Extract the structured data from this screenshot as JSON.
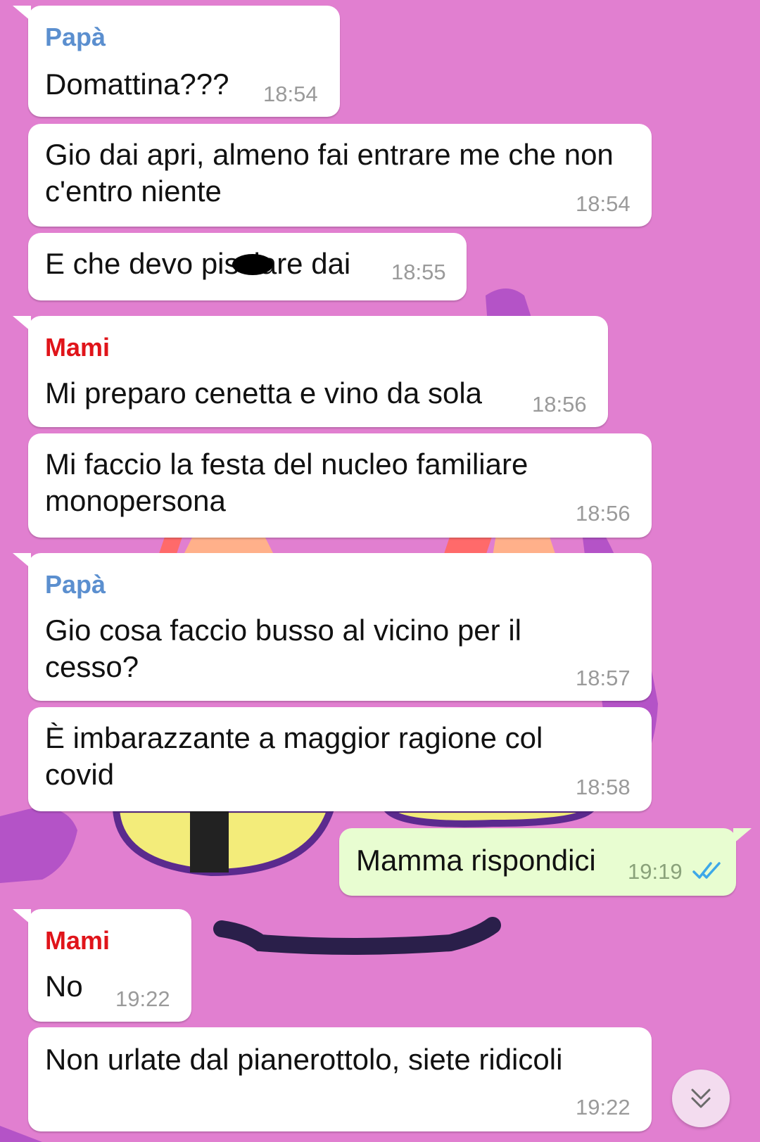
{
  "chat": {
    "messages": [
      {
        "sender": "Papà",
        "sender_color": "#5b8fcf",
        "text": "Domattina???",
        "time": "18:54"
      },
      {
        "sender": "",
        "text": "Gio dai apri, almeno fai entrare me che non\nc'entro niente",
        "time": "18:54"
      },
      {
        "sender": "",
        "text": "E che devo pisciare dai",
        "time": "18:55"
      },
      {
        "sender": "Mami",
        "sender_color": "#e0141a",
        "text": "Mi preparo cenetta e vino da sola",
        "time": "18:56"
      },
      {
        "sender": "",
        "text": "Mi faccio la festa del nucleo familiare\nmonopersona",
        "time": "18:56"
      },
      {
        "sender": "Papà",
        "sender_color": "#5b8fcf",
        "text": "Gio cosa faccio busso al vicino per il\ncesso?",
        "time": "18:57"
      },
      {
        "sender": "",
        "text": "È imbarazzante a maggior ragione col\ncovid",
        "time": "18:58"
      },
      {
        "sender": "me",
        "text": "Mamma rispondici",
        "time": "19:19",
        "status": "read-double-check"
      },
      {
        "sender": "Mami",
        "sender_color": "#e0141a",
        "text": "No",
        "time": "19:22"
      },
      {
        "sender": "",
        "text": "Non urlate dal pianerottolo, siete ridicoli",
        "time": "19:22"
      }
    ]
  },
  "colors": {
    "background": "#e17fd0",
    "incoming_bubble": "#ffffff",
    "outgoing_bubble": "#e8fdd1",
    "read_check": "#3da8e8"
  },
  "icons": {
    "read_status": "double-check-icon",
    "scroll": "chevron-double-down-icon"
  }
}
